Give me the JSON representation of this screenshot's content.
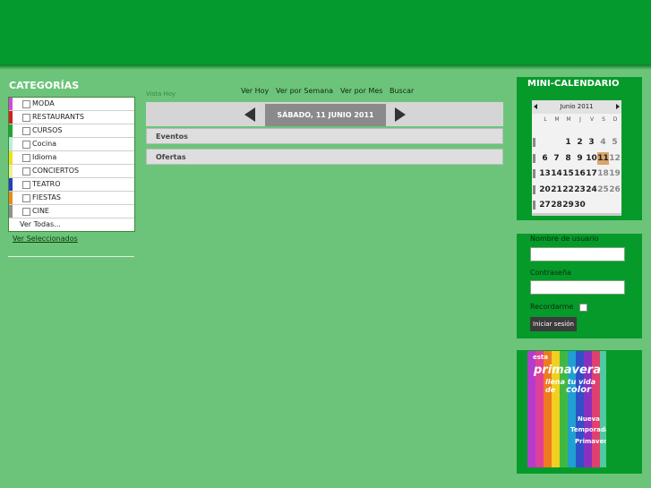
{
  "categories": {
    "title": "CATEGORÍAS",
    "items": [
      {
        "label": "MODA",
        "color": "#d24bd8"
      },
      {
        "label": "RESTAURANTS",
        "color": "#d02020"
      },
      {
        "label": "CURSOS",
        "color": "#1aa830"
      },
      {
        "label": "Cocina",
        "color": "#b8f0d8"
      },
      {
        "label": "Idioma",
        "color": "#f0e020"
      },
      {
        "label": "CONCIERTOS",
        "color": "#f0f090"
      },
      {
        "label": "TEATRO",
        "color": "#2040c0"
      },
      {
        "label": "FIESTAS",
        "color": "#f08820"
      },
      {
        "label": "CINE",
        "color": "#909090"
      }
    ],
    "all_label": "Ver Todas...",
    "selected_link": "Ver Seleccionados"
  },
  "center": {
    "vista_hoy": "Vista Hoy",
    "nav": [
      "Ver Hoy",
      "Ver por Semana",
      "Ver por Mes",
      "Buscar"
    ],
    "date": "SÁBADO, 11 JUNIO 2011",
    "sections": [
      "Eventos",
      "Ofertas"
    ]
  },
  "mini_calendar": {
    "title": "MINI-CALENDARIO",
    "month": "Junio 2011",
    "dow": [
      "L",
      "M",
      "M",
      "J",
      "V",
      "S",
      "D"
    ],
    "weeks": [
      [
        "",
        "",
        "1",
        "2",
        "3",
        "4",
        "5"
      ],
      [
        "6",
        "7",
        "8",
        "9",
        "10",
        "11",
        "12"
      ],
      [
        "13",
        "14",
        "15",
        "16",
        "17",
        "18",
        "19"
      ],
      [
        "20",
        "21",
        "22",
        "23",
        "24",
        "25",
        "26"
      ],
      [
        "27",
        "28",
        "29",
        "30",
        "",
        "",
        ""
      ]
    ],
    "today": "11"
  },
  "login": {
    "user_label": "Nombre de usuario",
    "pass_label": "Contraseña",
    "remember_label": "Recordarme",
    "button_label": "Iniciar sesión"
  },
  "ad": {
    "line1": "esta",
    "line2": "primavera",
    "line3": "llena tu vida de",
    "line4": "color",
    "line5": "Nueva",
    "line6": "Temporada",
    "line7": "Primavera"
  }
}
